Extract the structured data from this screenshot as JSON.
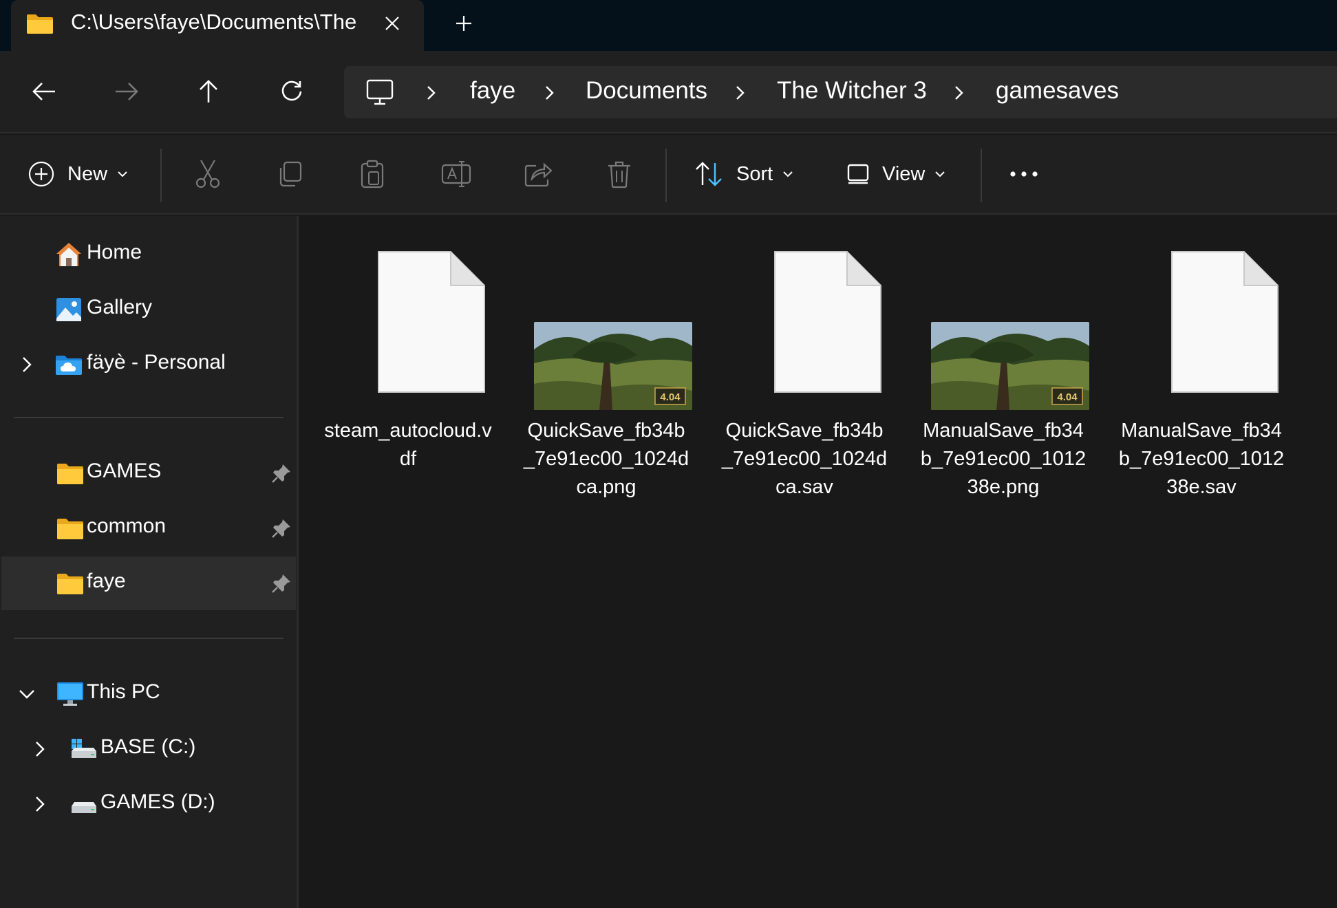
{
  "tab": {
    "title": "C:\\Users\\faye\\Documents\\The",
    "icon": "folder-icon"
  },
  "address": {
    "root_icon": "computer-icon",
    "crumbs": [
      "faye",
      "Documents",
      "The Witcher 3",
      "gamesaves"
    ]
  },
  "commands": {
    "new_label": "New",
    "sort_label": "Sort",
    "view_label": "View"
  },
  "sidebar": {
    "quick": [
      {
        "label": "Home",
        "icon": "home-icon"
      },
      {
        "label": "Gallery",
        "icon": "gallery-icon"
      },
      {
        "label": "fäyè - Personal",
        "icon": "onedrive-folder-icon"
      }
    ],
    "pinned": [
      {
        "label": "GAMES",
        "icon": "folder-icon"
      },
      {
        "label": "common",
        "icon": "folder-icon"
      },
      {
        "label": "faye",
        "icon": "folder-icon",
        "selected": true
      }
    ],
    "this_pc": {
      "label": "This PC",
      "icon": "computer-icon"
    },
    "drives": [
      {
        "label": "BASE (C:)",
        "icon": "windows-drive-icon"
      },
      {
        "label": "GAMES (D:)",
        "icon": "drive-icon"
      }
    ]
  },
  "files": [
    {
      "name": "steam_autocloud.vdf",
      "kind": "document"
    },
    {
      "name": "QuickSave_fb34b_7e91ec00_1024dca.png",
      "kind": "image",
      "badge": "4.04"
    },
    {
      "name": "QuickSave_fb34b_7e91ec00_1024dca.sav",
      "kind": "document"
    },
    {
      "name": "ManualSave_fb34b_7e91ec00_101238e.png",
      "kind": "image",
      "badge": "4.04"
    },
    {
      "name": "ManualSave_fb34b_7e91ec00_101238e.sav",
      "kind": "document"
    }
  ],
  "colors": {
    "folder": "#f5c518",
    "accent": "#4cc2ff",
    "background": "#191919",
    "chrome": "#202020"
  }
}
